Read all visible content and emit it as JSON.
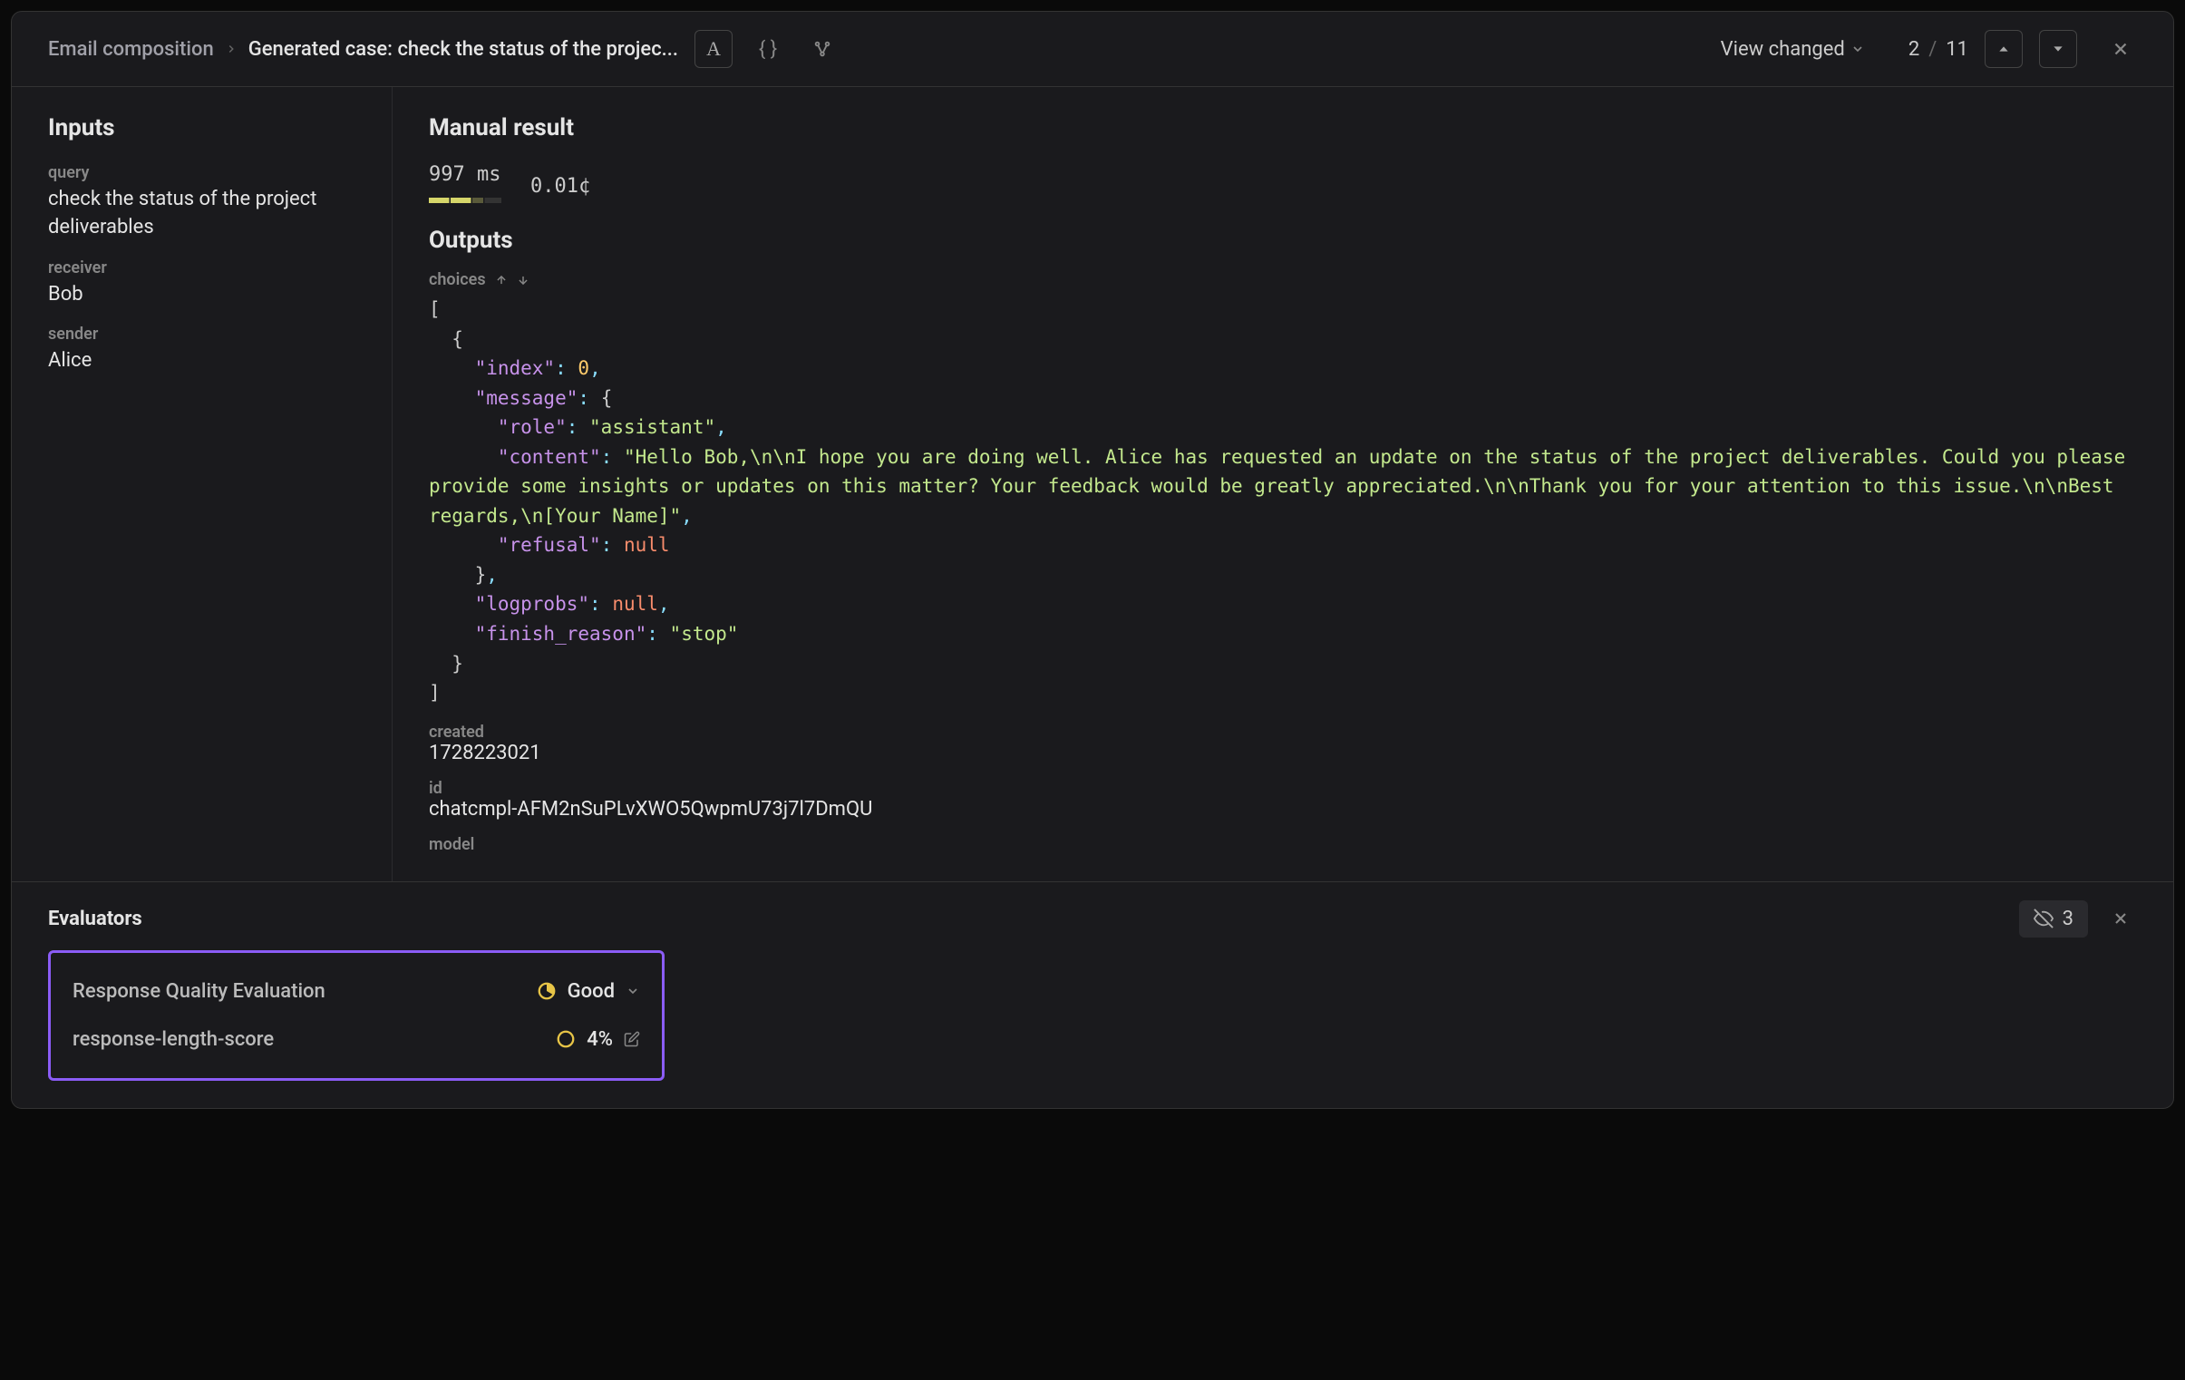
{
  "breadcrumb": {
    "parent": "Email composition",
    "current": "Generated case: check the status of the projec..."
  },
  "toolbar": {
    "view_changed_label": "View changed",
    "page_current": "2",
    "page_total": "11"
  },
  "sidebar": {
    "title": "Inputs",
    "fields": {
      "query_label": "query",
      "query_value": "check the status of the project deliverables",
      "receiver_label": "receiver",
      "receiver_value": "Bob",
      "sender_label": "sender",
      "sender_value": "Alice"
    }
  },
  "main": {
    "title": "Manual result",
    "latency": "997 ms",
    "cost": "0.01¢",
    "outputs_title": "Outputs",
    "choices_label": "choices",
    "choices_json": {
      "index_key": "\"index\"",
      "index_val": "0",
      "message_key": "\"message\"",
      "role_key": "\"role\"",
      "role_val": "\"assistant\"",
      "content_key": "\"content\"",
      "content_val": "\"Hello Bob,\\n\\nI hope you are doing well. Alice has requested an update on the status of the project deliverables. Could you please provide some insights or updates on this matter? Your feedback would be greatly appreciated.\\n\\nThank you for your attention to this issue.\\n\\nBest regards,\\n[Your Name]\"",
      "refusal_key": "\"refusal\"",
      "refusal_val": "null",
      "logprobs_key": "\"logprobs\"",
      "logprobs_val": "null",
      "finish_reason_key": "\"finish_reason\"",
      "finish_reason_val": "\"stop\""
    },
    "created_label": "created",
    "created_value": "1728223021",
    "id_label": "id",
    "id_value": "chatcmpl-AFM2nSuPLvXWO5QwpmU73j7l7DmQU",
    "model_label": "model"
  },
  "evaluators": {
    "title": "Evaluators",
    "hidden_count": "3",
    "rows": {
      "rqe_label": "Response Quality Evaluation",
      "rqe_value": "Good",
      "rls_label": "response-length-score",
      "rls_value": "4%"
    }
  },
  "colors": {
    "highlight": "#8b5cf6",
    "good": "#e8c547",
    "warn": "#e8c547"
  }
}
